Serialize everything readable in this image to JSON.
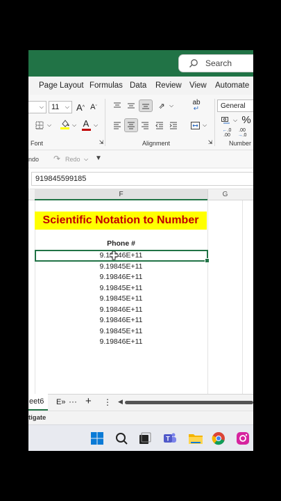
{
  "search": {
    "label": "Search"
  },
  "tabs": [
    "Page Layout",
    "Formulas",
    "Data",
    "Review",
    "View",
    "Automate"
  ],
  "ribbon": {
    "font_size": "11",
    "number_format": "General",
    "percent": "%",
    "groups": {
      "font": "Font",
      "alignment": "Alignment",
      "number": "Number"
    }
  },
  "qat": {
    "undo": "ndo",
    "redo": "Redo"
  },
  "formula_bar": {
    "value": "919845599185"
  },
  "columns": [
    "F",
    "G"
  ],
  "sheet": {
    "title": "Scientific Notation to Number",
    "column_header": "Phone #",
    "values": [
      "9.19846E+11",
      "9.19845E+11",
      "9.19846E+11",
      "9.19845E+11",
      "9.19845E+11",
      "9.19846E+11",
      "9.19846E+11",
      "9.19845E+11",
      "9.19846E+11"
    ]
  },
  "sheet_tabs": {
    "active": "eet6",
    "next": "E»",
    "add": "+",
    "more": "⋮"
  },
  "status": {
    "text": "tigate"
  },
  "colors": {
    "excel_green": "#217346",
    "title_fill": "#ffff00",
    "title_text": "#c00000"
  }
}
